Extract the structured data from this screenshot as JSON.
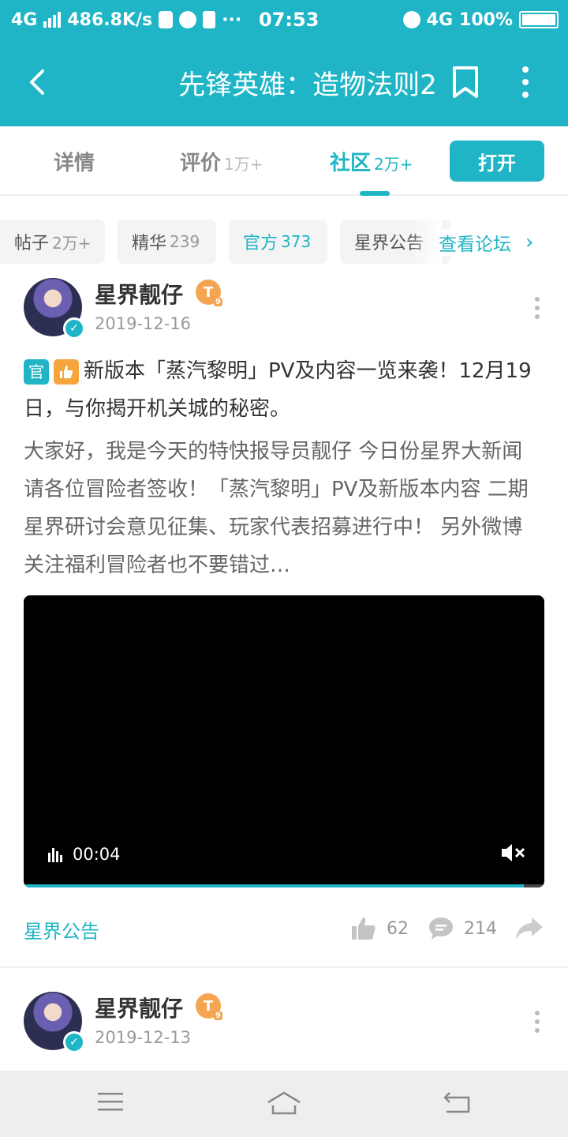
{
  "status_bar": {
    "network": "4G",
    "speed": "486.8K/s",
    "time": "07:53",
    "network_right": "4G",
    "battery": "100%"
  },
  "header": {
    "title": "先锋英雄：造物法则2",
    "icons": [
      "back-arrow-icon",
      "bookmark-icon",
      "more-vertical-icon"
    ]
  },
  "tabs": {
    "items": [
      {
        "label": "详情",
        "count": ""
      },
      {
        "label": "评价",
        "count": "1万+"
      },
      {
        "label": "社区",
        "count": "2万+"
      }
    ],
    "active": "社区",
    "open_button": "打开"
  },
  "chips": {
    "items": [
      {
        "label": "帖子",
        "count": "2万+"
      },
      {
        "label": "精华",
        "count": "239"
      },
      {
        "label": "官方",
        "count": "373"
      },
      {
        "label": "星界公告",
        "count": ""
      }
    ],
    "active": "官方",
    "forum_link": "查看论坛",
    "forum_link_icon": "chevron-right-icon"
  },
  "posts": [
    {
      "author": "星界靓仔",
      "level": "T",
      "level_sub": "9",
      "date": "2019-12-16",
      "tag_official": "官",
      "title": "新版本「蒸汽黎明」PV及内容一览来袭！12月19日，与你揭开机关城的秘密。",
      "body": "大家好，我是今天的特快报导员靓仔 今日份星界大新闻请各位冒险者签收！「蒸汽黎明」PV及新版本内容 二期星界研讨会意见征集、玩家代表招募进行中！ 另外微博关注福利冒险者也不要错过…",
      "video_time": "00:04",
      "video_progress": 0.96,
      "board": "星界公告",
      "likes": "62",
      "comments": "214"
    },
    {
      "author": "星界靓仔",
      "level": "T",
      "level_sub": "9",
      "date": "2019-12-13"
    }
  ],
  "colors": {
    "accent": "#1fb5c6",
    "hot_tag": "#f6a53d",
    "level_badge": "#f5a551"
  }
}
